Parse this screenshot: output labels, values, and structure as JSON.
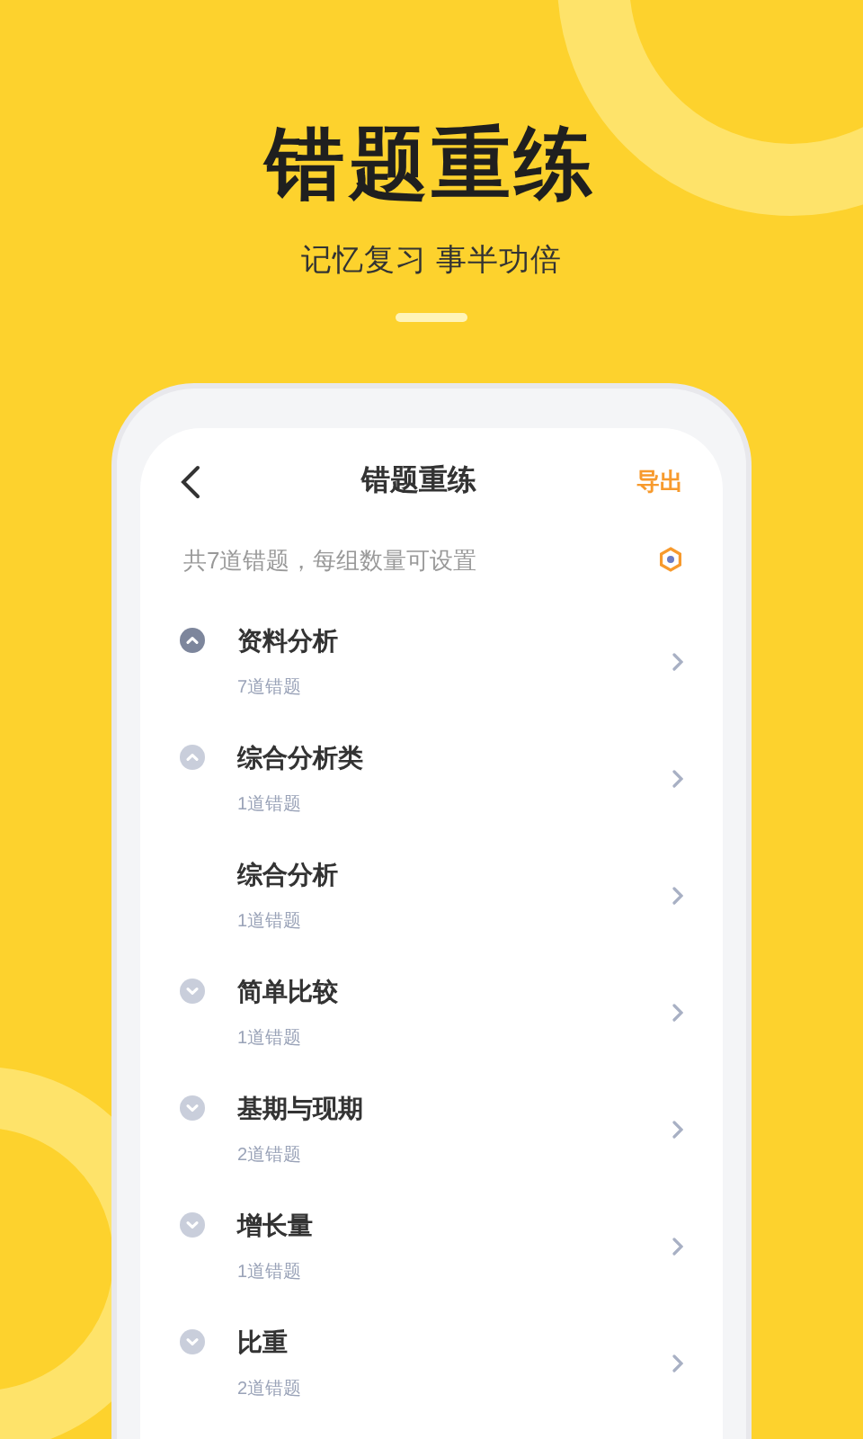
{
  "headline": "错题重练",
  "tagline": "记忆复习 事半功倍",
  "screen": {
    "title": "错题重练",
    "action": "导出",
    "summary": "共7道错题，每组数量可设置",
    "tree": [
      {
        "name": "资料分析",
        "count": "7道错题",
        "expanded": true,
        "children": [
          {
            "name": "综合分析类",
            "count": "1道错题",
            "expanded": true,
            "children": [
              {
                "name": "综合分析",
                "count": "1道错题"
              }
            ]
          },
          {
            "name": "简单比较",
            "count": "1道错题",
            "expanded": false
          },
          {
            "name": "基期与现期",
            "count": "2道错题",
            "expanded": false
          },
          {
            "name": "增长量",
            "count": "1道错题",
            "expanded": false
          },
          {
            "name": "比重",
            "count": "2道错题",
            "expanded": false
          }
        ]
      }
    ]
  }
}
